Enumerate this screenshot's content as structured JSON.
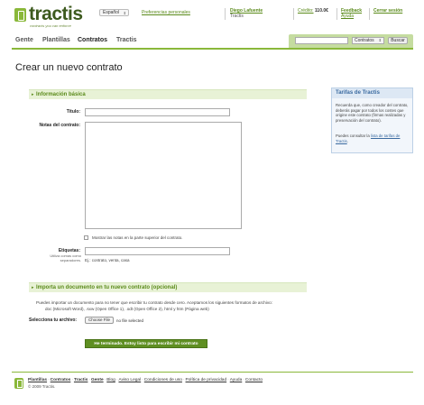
{
  "header": {
    "logo_text": "tractis",
    "tagline": "contracts you can enforce",
    "language": "Español",
    "preferences": "Preferencias personales",
    "user_name": "Diego Lafuente",
    "user_sub": "Tractis",
    "credit_label": "Crédito:",
    "credit_value": "110.0€",
    "feedback": "Feedback",
    "help": "Ayuda",
    "logout": "Cerrar sesión"
  },
  "nav": {
    "items": [
      "Gente",
      "Plantillas",
      "Contratos",
      "Tractis"
    ],
    "active": "Contratos",
    "search_select": "Contratos",
    "search_button": "Buscar"
  },
  "page": {
    "title": "Crear un nuevo contrato"
  },
  "basic": {
    "section_title": "Información básica",
    "title_label": "Título:",
    "title_value": "",
    "notes_label": "Notas del contrato:",
    "notes_value": "",
    "show_notes_label": "Mostrar las notas en la parte superior del contrato.",
    "tags_label": "Etiquetas:",
    "tags_hint": "Utiliza comas como separadores.",
    "tags_example": "Ej.: contrato, venta, casa"
  },
  "import": {
    "section_title": "Importa un documento en tu nuevo contrato (opcional)",
    "text_line1": "Puedes importar un documento para no tener que escribir tu contrato desde cero. Aceptamos los siguientes formatos de archivo:",
    "text_line2": "doc (Microsoft Word), .sxw (Open Office 1), .odt (Open Office 2), html y htm (Página web)",
    "file_label": "Selecciona tu archivo:",
    "choose_button": "Choose File",
    "no_file": "no file selected"
  },
  "submit_label": "He terminado. Estoy listo para escribir mi contrato",
  "sidebar": {
    "title": "Tarifas de Tractis",
    "text": "Recuerda que, como creador del contrato, deberás pagar por todos los costes que origine este contrato (firmas realizadas y preservación del contrato).",
    "text2_prefix": "Puedes consultar la",
    "text2_link": "lista de tarifas de Tractis",
    "text2_suffix": "."
  },
  "footer": {
    "links": [
      "Plantillas",
      "Contratos",
      "Tractis",
      "Gente",
      "Blog",
      "Aviso Legal",
      "Condiciones de uso",
      "Política de privacidad",
      "Ayuda",
      "Contacto"
    ],
    "copyright": "© 2009 Tractis."
  },
  "colors": {
    "accent_green": "#8ab83a",
    "link_green": "#5a8a1a",
    "button_green": "#5f8f22",
    "sidebar_blue": "#3a6aa0"
  }
}
